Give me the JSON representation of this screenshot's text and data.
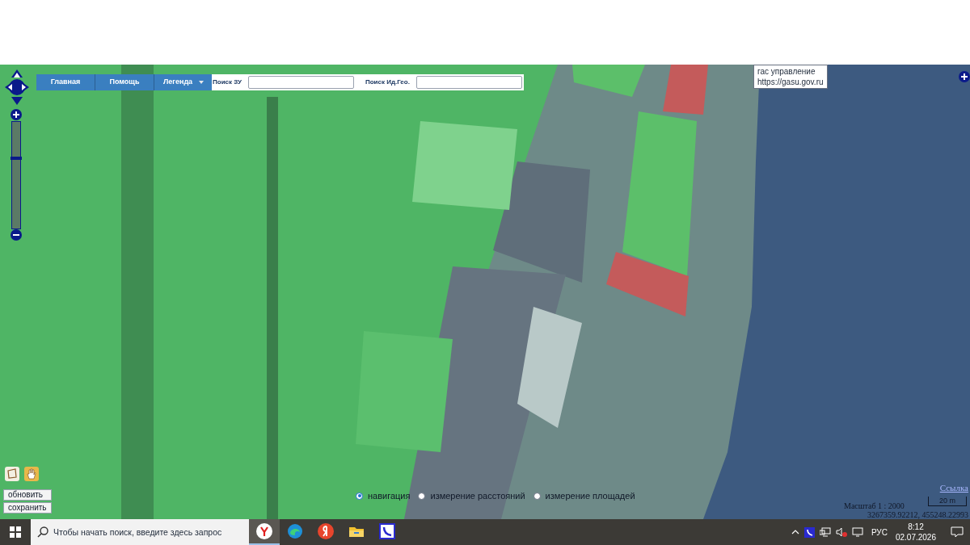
{
  "menu": [
    {
      "label": "Главная",
      "dropdown": false
    },
    {
      "label": "Помощь",
      "dropdown": false
    },
    {
      "label": "Легенда",
      "dropdown": true
    }
  ],
  "search_fields": [
    {
      "label": "Поиск ЗУ"
    },
    {
      "label": "Поиск Ид.Гео."
    }
  ],
  "zoom": {
    "level": 0.67
  },
  "tooltip": {
    "title": "гас управление",
    "url": "https://gasu.gov.ru"
  },
  "tools": [
    {
      "kind": "select"
    },
    {
      "kind": "pan"
    }
  ],
  "buttons": [
    "обновить",
    "сохранить"
  ],
  "modes": [
    {
      "label": "навигация",
      "selected": true
    },
    {
      "label": "измерение расстояний",
      "selected": false
    },
    {
      "label": "измерение площадей",
      "selected": false
    }
  ],
  "link": "Ссылка",
  "scale": {
    "label": "Масштаб 1 : 2000",
    "bar_label": "20 m"
  },
  "coordinates": "3267359.92212, 455248.22993",
  "taskbar": {
    "search": {
      "placeholder": "Чтобы начать поиск, введите здесь запрос"
    },
    "apps": [
      {
        "kind": "yandex-browser",
        "selected": true
      },
      {
        "kind": "edge",
        "selected": false
      },
      {
        "kind": "yandex",
        "selected": false
      },
      {
        "kind": "folder",
        "selected": false
      },
      {
        "kind": "phone",
        "selected": false
      }
    ],
    "language": "РУС",
    "time": "8:12",
    "date": "02.07.2026"
  }
}
